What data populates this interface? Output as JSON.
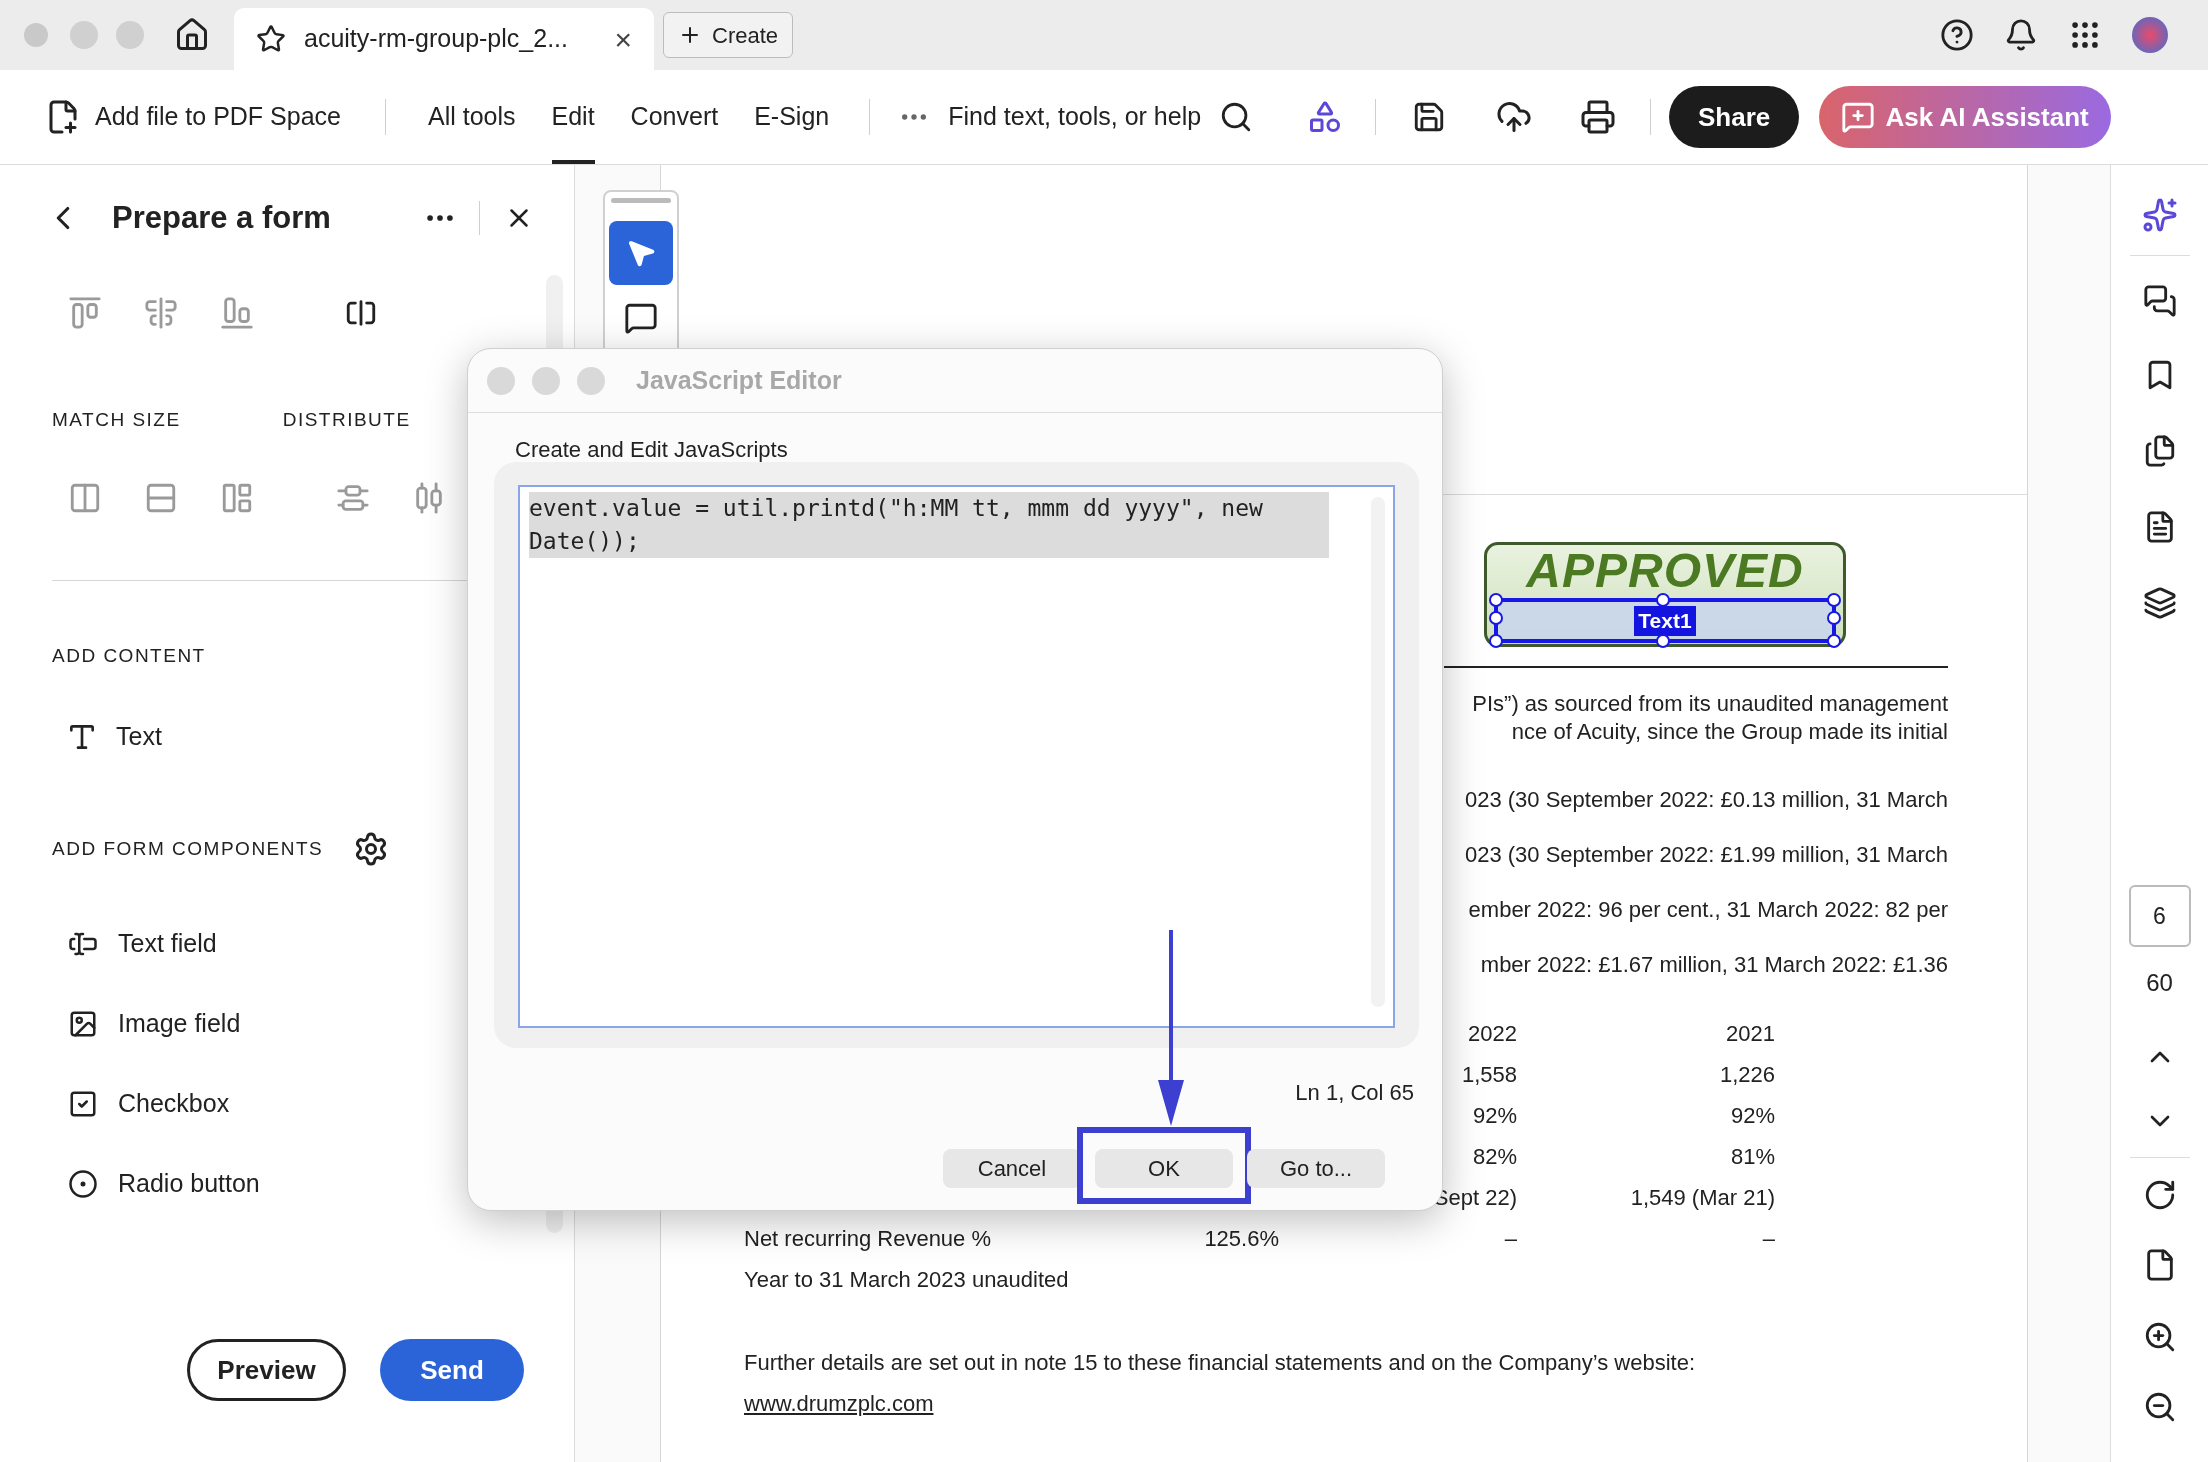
{
  "browser": {
    "tab_title": "acuity-rm-group-plc_2...",
    "tab_close": "×",
    "create": "Create"
  },
  "toolbar": {
    "add_file": "Add file to PDF Space",
    "menu": [
      {
        "label": "All tools",
        "selected": false
      },
      {
        "label": "Edit",
        "selected": true
      },
      {
        "label": "Convert",
        "selected": false
      },
      {
        "label": "E-Sign",
        "selected": false
      }
    ],
    "search": "Find text, tools, or help",
    "share": "Share",
    "ai_assistant": "Ask AI Assistant"
  },
  "panel": {
    "title": "Prepare a form",
    "match_size": "MATCH SIZE",
    "distribute": "DISTRIBUTE",
    "add_content": "ADD CONTENT",
    "content_items": [
      {
        "kind": "text",
        "label": "Text"
      }
    ],
    "add_form_components": "ADD FORM COMPONENTS",
    "components": [
      {
        "kind": "text_field",
        "label": "Text field"
      },
      {
        "kind": "image_field",
        "label": "Image field"
      },
      {
        "kind": "checkbox",
        "label": "Checkbox"
      },
      {
        "kind": "radio",
        "label": "Radio button"
      }
    ],
    "preview": "Preview",
    "send": "Send"
  },
  "document": {
    "stamp": "APPROVED",
    "field_label": "Text1",
    "paragraph_lines": [
      "PIs”) as sourced from its unaudited management",
      "nce of Acuity, since the Group made its initial"
    ],
    "kpi_lines": [
      "023 (30 September 2022: £0.13 million, 31 March",
      "023 (30 September 2022: £1.99 million, 31 March",
      "ember 2022: 96 per cent., 31 March 2022: 82 per",
      "mber 2022: £1.67 million, 31 March 2022: £1.36"
    ],
    "table": {
      "columns": [
        "2022",
        "2021"
      ],
      "rows": [
        [
          "1,558",
          "1,226"
        ],
        [
          "92%",
          "92%"
        ],
        [
          "82%",
          "81%"
        ],
        [
          "Sept 22)",
          "1,549 (Mar 21)"
        ]
      ],
      "last_row": {
        "label": "Net recurring Revenue %",
        "value": "125.6%",
        "col_2022": "–",
        "col_2021": "–"
      }
    },
    "note": "Year to 31 March 2023 unaudited",
    "further": "Further details are set out in note 15 to these financial statements and on the Company’s website:",
    "link": "www.drumzplc.com"
  },
  "dialog": {
    "title": "JavaScript Editor",
    "label": "Create and Edit JavaScripts",
    "code": "event.value = util.printd(\"h:MM tt, mmm dd yyyy\", new Date());",
    "cursor": "Ln 1, Col 65",
    "buttons": [
      {
        "label": "Cancel",
        "highlighted": false
      },
      {
        "label": "OK",
        "highlighted": true
      },
      {
        "label": "Go to...",
        "highlighted": false
      }
    ]
  },
  "right_rail": {
    "page": "6",
    "total": "60"
  }
}
